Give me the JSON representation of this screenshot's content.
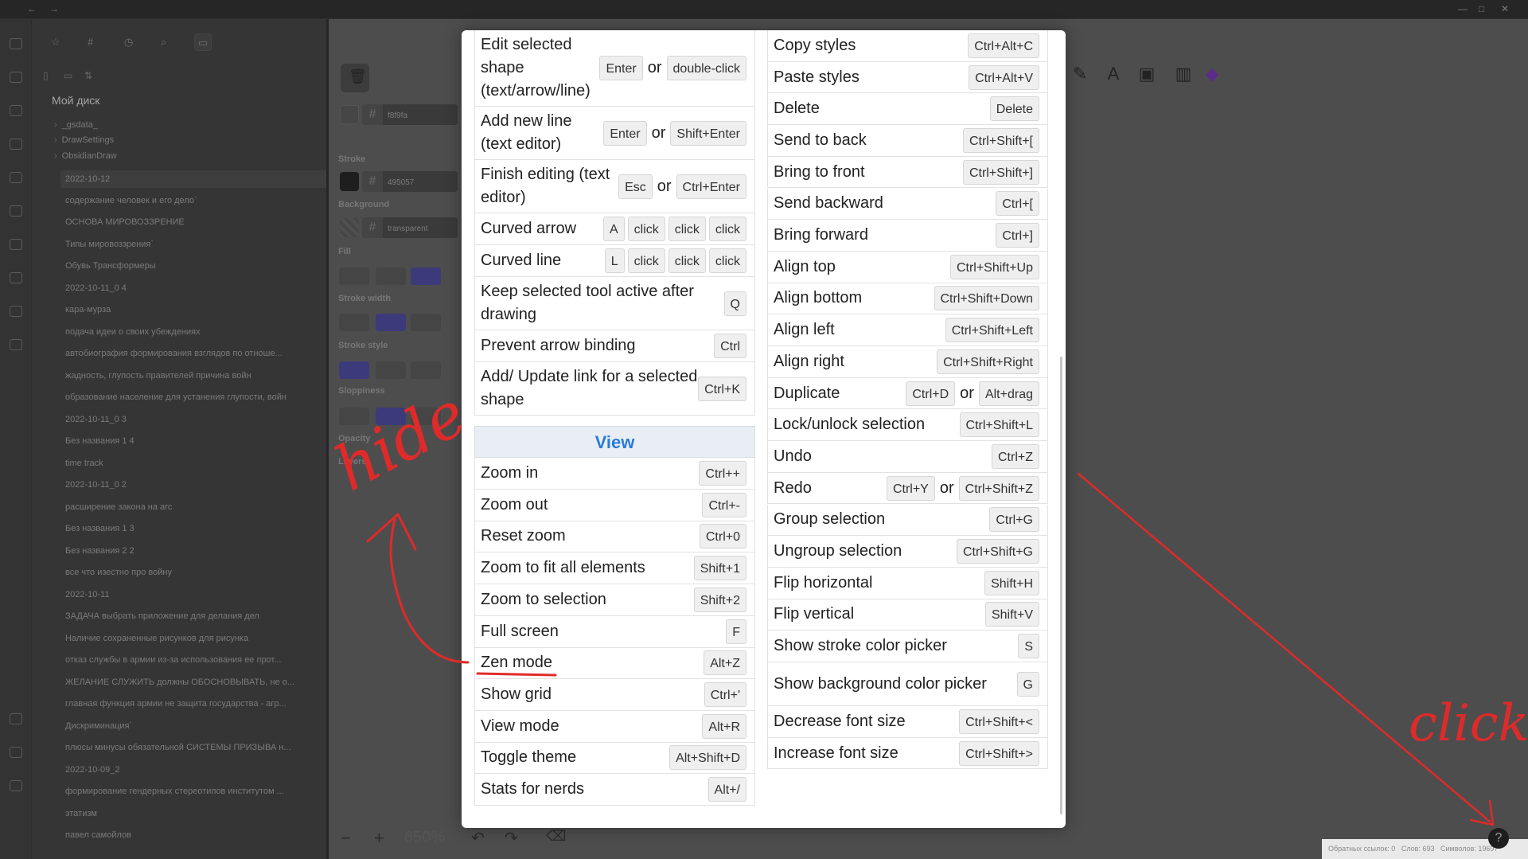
{
  "sidebar": {
    "vault_name": "Мой диск",
    "folders": [
      "_gsdata_",
      "DrawSettings",
      "ObsidianDraw"
    ],
    "files": [
      "2022-10-12",
      "содержание человек и его дело`",
      "ОСНОВА МИРОВОЗЗРЕНИЕ",
      "Типы мировоззрения`",
      "Обувь Трансформеры",
      "2022-10-11_0 4",
      "кара-мурза",
      "подача идеи о своих убеждениях",
      "автобиография формирования взглядов по отноше...",
      "жадность, глупость правителей причина войн",
      "образование население для устанения глупости, войн",
      "2022-10-11_0 3",
      "Без названия 1 4",
      "time track",
      "2022-10-11_0 2",
      "расширение закона на агс",
      "Без названия 1 3",
      "Без названия 2 2",
      "все что изеcтно про войну",
      "2022-10-11",
      "ЗАДАЧА выбрать приложение для делания дел",
      "Наличие сохраненные рисунков для рисунка",
      "отказ службы в армии из-за использования ее прот...",
      "ЖЕЛАНИЕ СЛУЖИТЬ должны ОБОСНОВЫВАТЬ, не о...",
      "главная функция армии не защита государства - агр...",
      "Дискриминация`",
      "плюсы минусы обязательной СИСТЕМЫ ПРИЗЫВА н...",
      "2022-10-09_2",
      "формирование гендерных стереотипов институтом ...",
      "этатизм",
      "павел самойлов"
    ]
  },
  "props": {
    "background_hex": "f8f9fa",
    "stroke_label": "Stroke",
    "stroke_hex": "495057",
    "background_label": "Background",
    "bg_hex": "transparent",
    "fill_label": "Fill",
    "stroke_width_label": "Stroke width",
    "stroke_style_label": "Stroke style",
    "sloppiness_label": "Sloppiness",
    "opacity_label": "Opacity",
    "layers_label": "Layers"
  },
  "canvas": {
    "zoom": "650%",
    "zoom_out": "−",
    "zoom_in": "+"
  },
  "status_bar": {
    "backlinks": "Обратных ссылок: 0",
    "words": "Слов: 693",
    "chars": "Символов: 19697"
  },
  "modal": {
    "left_rows": [
      {
        "label": "Edit selected shape (text/arrow/line)",
        "keys": [
          "Enter",
          "or",
          "double-click"
        ]
      },
      {
        "label": "Add new line (text editor)",
        "keys": [
          "Enter",
          "or",
          "Shift+Enter"
        ]
      },
      {
        "label": "Finish editing (text editor)",
        "keys": [
          "Esc",
          "or",
          "Ctrl+Enter"
        ]
      },
      {
        "label": "Curved arrow",
        "keys": [
          "A",
          "click",
          "click",
          "click"
        ]
      },
      {
        "label": "Curved line",
        "keys": [
          "L",
          "click",
          "click",
          "click"
        ]
      },
      {
        "label": "Keep selected tool active after drawing",
        "keys": [
          "Q"
        ]
      },
      {
        "label": "Prevent arrow binding",
        "keys": [
          "Ctrl"
        ]
      },
      {
        "label": "Add/ Update link for a selected shape",
        "keys": [
          "Ctrl+K"
        ]
      }
    ],
    "view_heading": "View",
    "view_rows": [
      {
        "label": "Zoom in",
        "keys": [
          "Ctrl++"
        ]
      },
      {
        "label": "Zoom out",
        "keys": [
          "Ctrl+-"
        ]
      },
      {
        "label": "Reset zoom",
        "keys": [
          "Ctrl+0"
        ]
      },
      {
        "label": "Zoom to fit all elements",
        "keys": [
          "Shift+1"
        ]
      },
      {
        "label": "Zoom to selection",
        "keys": [
          "Shift+2"
        ]
      },
      {
        "label": "Full screen",
        "keys": [
          "F"
        ]
      },
      {
        "label": "Zen mode",
        "keys": [
          "Alt+Z"
        ]
      },
      {
        "label": "Show grid",
        "keys": [
          "Ctrl+'"
        ]
      },
      {
        "label": "View mode",
        "keys": [
          "Alt+R"
        ]
      },
      {
        "label": "Toggle theme",
        "keys": [
          "Alt+Shift+D"
        ]
      },
      {
        "label": "Stats for nerds",
        "keys": [
          "Alt+/"
        ]
      }
    ],
    "right_rows": [
      {
        "label": "Copy styles",
        "keys": [
          "Ctrl+Alt+C"
        ]
      },
      {
        "label": "Paste styles",
        "keys": [
          "Ctrl+Alt+V"
        ]
      },
      {
        "label": "Delete",
        "keys": [
          "Delete"
        ]
      },
      {
        "label": "Send to back",
        "keys": [
          "Ctrl+Shift+["
        ]
      },
      {
        "label": "Bring to front",
        "keys": [
          "Ctrl+Shift+]"
        ]
      },
      {
        "label": "Send backward",
        "keys": [
          "Ctrl+["
        ]
      },
      {
        "label": "Bring forward",
        "keys": [
          "Ctrl+]"
        ]
      },
      {
        "label": "Align top",
        "keys": [
          "Ctrl+Shift+Up"
        ]
      },
      {
        "label": "Align bottom",
        "keys": [
          "Ctrl+Shift+Down"
        ]
      },
      {
        "label": "Align left",
        "keys": [
          "Ctrl+Shift+Left"
        ]
      },
      {
        "label": "Align right",
        "keys": [
          "Ctrl+Shift+Right"
        ]
      },
      {
        "label": "Duplicate",
        "keys": [
          "Ctrl+D",
          "or",
          "Alt+drag"
        ]
      },
      {
        "label": "Lock/unlock selection",
        "keys": [
          "Ctrl+Shift+L"
        ]
      },
      {
        "label": "Undo",
        "keys": [
          "Ctrl+Z"
        ]
      },
      {
        "label": "Redo",
        "keys": [
          "Ctrl+Y",
          "or",
          "Ctrl+Shift+Z"
        ]
      },
      {
        "label": "Group selection",
        "keys": [
          "Ctrl+G"
        ]
      },
      {
        "label": "Ungroup selection",
        "keys": [
          "Ctrl+Shift+G"
        ]
      },
      {
        "label": "Flip horizontal",
        "keys": [
          "Shift+H"
        ]
      },
      {
        "label": "Flip vertical",
        "keys": [
          "Shift+V"
        ]
      },
      {
        "label": "Show stroke color picker",
        "keys": [
          "S"
        ]
      },
      {
        "label": "Show background color picker",
        "keys": [
          "G"
        ]
      },
      {
        "label": "Decrease font size",
        "keys": [
          "Ctrl+Shift+<"
        ]
      },
      {
        "label": "Increase font size",
        "keys": [
          "Ctrl+Shift+>"
        ]
      }
    ]
  },
  "annotations": {
    "hide_text": "hide",
    "click_text": "click",
    "color": "#e02a2a"
  },
  "colors": {
    "accent": "#2a7ad8",
    "selected_option": "#3c3a7a"
  }
}
